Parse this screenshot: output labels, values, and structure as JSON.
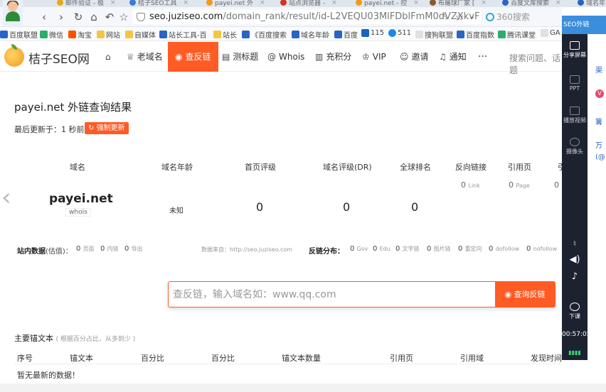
{
  "browser": {
    "tabs": [
      {
        "label": "邮件验证 - 极",
        "color": "#e6a817"
      },
      {
        "label": "桔子SEO工具",
        "color": "#3a7bd5"
      },
      {
        "label": "payei.net 外",
        "color": "#f39a1a"
      },
      {
        "label": "站点浏览器 -",
        "color": "#d93025"
      },
      {
        "label": "payei.net - 控",
        "color": "#f39a1a"
      },
      {
        "label": "布羅球厂家 [",
        "color": "#8a5a2b"
      },
      {
        "label": "百度文库搜索",
        "color": "#2a64c4"
      },
      {
        "label": "域名年",
        "color": "#2a64c4"
      }
    ],
    "url_host": "seo.juziseo.com",
    "url_path": "/domain_rank/result/id-L2VEQU03MlFDblFmM0dVZXkvF",
    "search_placeholder": "360搜索",
    "bookmarks": [
      {
        "label": "百度联盟",
        "color": "#2a64c4"
      },
      {
        "label": "微信",
        "color": "#2aae67"
      },
      {
        "label": "淘宝",
        "color": "#ff5000"
      },
      {
        "label": "网站",
        "color": "#f5c542"
      },
      {
        "label": "自媒体",
        "color": "#f5c542"
      },
      {
        "label": "站长工具-百",
        "color": "#2a64c4"
      },
      {
        "label": "站长",
        "color": "#f5c542"
      },
      {
        "label": "《百度搜索",
        "color": "#2a64c4"
      },
      {
        "label": "域名年龄",
        "color": "#2a64c4"
      },
      {
        "label": "百度",
        "color": "#2a64c4"
      },
      {
        "label": "115",
        "color": "#1565c0"
      },
      {
        "label": "511",
        "color": "#1e88e5"
      },
      {
        "label": "搜狗联盟",
        "color": "#e0e0e0"
      },
      {
        "label": "百度指数",
        "color": "#2a64c4"
      },
      {
        "label": "腾讯课堂",
        "color": "#2aae67"
      },
      {
        "label": "GA",
        "color": "#e0e0e0"
      }
    ]
  },
  "site": {
    "brand": "桔子SEO网",
    "nav": [
      "老域名",
      "查反链",
      "测标题",
      "Whois",
      "充积分",
      "VIP",
      "邀请",
      "通知",
      "···"
    ],
    "search_placeholder": "搜索问题、话题"
  },
  "main": {
    "title": "payei.net 外链查询结果",
    "last_updated": "最后更新于：1 秒前",
    "force_update": "强制更新",
    "table_headers": [
      "域名",
      "域名年龄",
      "首页评级",
      "域名评级(DR)",
      "全球排名",
      "反向链接",
      "引用页",
      "引"
    ],
    "sub_counts": [
      {
        "value": "0",
        "unit": "Link"
      },
      {
        "value": "0",
        "unit": "Page"
      },
      {
        "value": "0",
        "unit": ""
      }
    ],
    "domain": "payei.net",
    "whois": "whois",
    "age": "未知",
    "homepage_rating": "0",
    "domain_rating": "0",
    "global_rank": "0",
    "site_data_label": "站内数据",
    "site_data_note": "(估值)：",
    "site_data": [
      {
        "value": "0",
        "unit": "页面"
      },
      {
        "value": "0",
        "unit": "内链"
      },
      {
        "value": "0",
        "unit": "导出"
      }
    ],
    "data_source": "数据来自：http://seo.juziseo.com",
    "backlink_dist_label": "反链分布：",
    "backlink_dist": [
      {
        "value": "0",
        "unit": "Gov"
      },
      {
        "value": "0",
        "unit": "Edu"
      },
      {
        "value": "0",
        "unit": "文字链"
      },
      {
        "value": "0",
        "unit": "图片链"
      },
      {
        "value": "0",
        "unit": "重定向"
      },
      {
        "value": "0",
        "unit": "dofollow"
      },
      {
        "value": "0",
        "unit": "nofollow"
      }
    ],
    "query_placeholder": "查反链，输入域名如：www.qq.com",
    "query_button": "查询反链",
    "anchor_title": "主要锚文本",
    "anchor_note": "( 根据百分占比，从多到少 )",
    "anchor_headers": [
      "序号",
      "锚文本",
      "百分比",
      "百分比",
      "锚文本数量",
      "引用页",
      "引用域",
      "发现时间"
    ],
    "no_data": "暂无最新的数据！"
  },
  "sidebar": {
    "badge": "SEO外链",
    "share": "分享屏幕",
    "ppt": "PPT",
    "video": "播放视频",
    "camera": "摄像头",
    "lecture": "下课",
    "time": "00:57:05"
  },
  "right_panel": [
    "渠",
    "V",
    "篝",
    "万",
    "(@"
  ]
}
